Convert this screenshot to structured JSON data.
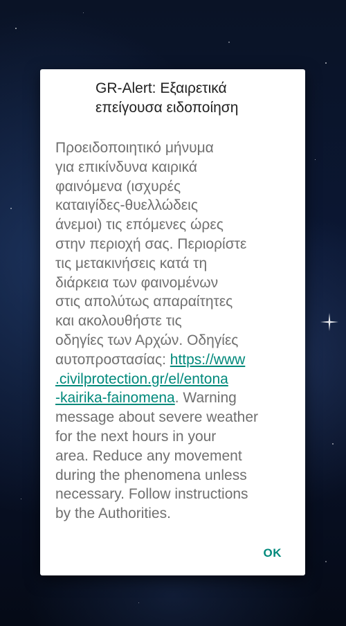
{
  "dialog": {
    "title_line1": "GR-Alert: Εξαιρετικά",
    "title_line2": "επείγουσα ειδοποίηση",
    "body_lines": [
      "Προειδοποιητικό μήνυμα",
      "για επικίνδυνα καιρικά",
      "φαινόμενα (ισχυρές",
      "καταιγίδες-θυελλώδεις",
      "άνεμοι) τις επόμενες  ώρες",
      "στην περιοχή σας. Περιορίστε",
      "τις μετακινήσεις κατά τη",
      "διάρκεια των φαινομένων",
      "στις απολύτως απαραίτητες",
      "και ακολουθήστε τις",
      "οδηγίες των Αρχών. Οδηγίες"
    ],
    "link_prefix": "αυτοπροστασίας: ",
    "link_line1": "https://www",
    "link_line2": ".civilprotection.gr/el/entona",
    "link_line3": "-kairika-fainomena",
    "after_link": ". Warning",
    "english_lines": [
      "message about severe weather",
      "for the next hours in your",
      "area. Reduce any movement",
      "during the phenomena unless",
      "necessary. Follow instructions",
      "by the Authorities."
    ],
    "ok_label": "OK"
  },
  "colors": {
    "accent": "#00897b",
    "body_text": "#6f6f6f",
    "title_text": "#212121",
    "dialog_bg": "#ffffff"
  },
  "icons": {
    "sparkle": "sparkle-star-icon"
  }
}
